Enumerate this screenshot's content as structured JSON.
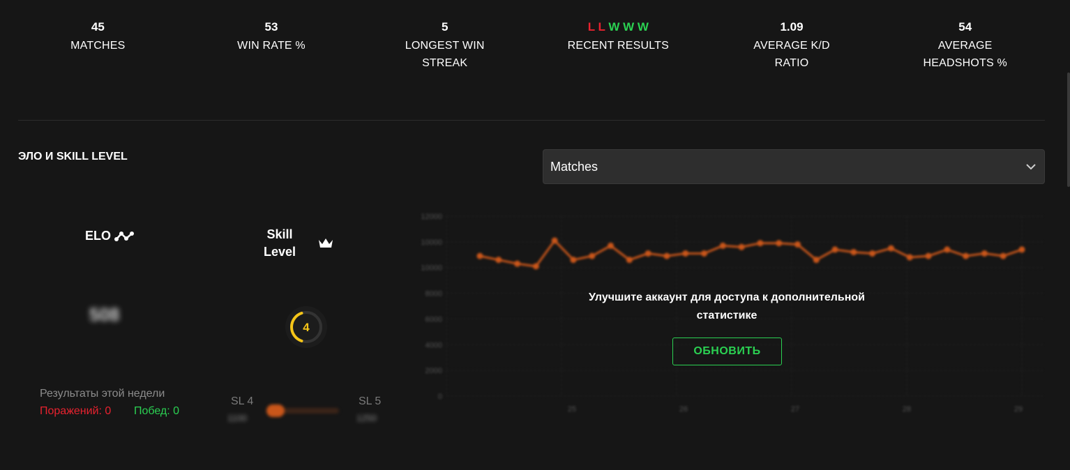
{
  "stats": [
    {
      "value": "45",
      "label": "MATCHES"
    },
    {
      "value": "53",
      "label": "WIN RATE %"
    },
    {
      "value": "5",
      "label": "LONGEST WIN\nSTREAK"
    },
    {
      "value": "",
      "label": "RECENT RESULTS"
    },
    {
      "value": "1.09",
      "label": "AVERAGE K/D\nRATIO"
    },
    {
      "value": "54",
      "label": "AVERAGE\nHEADSHOTS %"
    }
  ],
  "recent_results": [
    "L",
    "L",
    "W",
    "W",
    "W"
  ],
  "colors": {
    "loss": "#e8222f",
    "win": "#2bd152",
    "accent": "#c9561a",
    "skill": "#f5c518"
  },
  "section": {
    "title": "ЭЛО И SKILL LEVEL"
  },
  "dropdown": {
    "selected": "Matches",
    "icon": "chevron-down-icon"
  },
  "elo": {
    "title": "ELO",
    "icon": "elo-graph-icon",
    "value_blurred": "508"
  },
  "skill": {
    "title": "Skill\nLevel",
    "icon": "crown-icon",
    "level": "4",
    "level_fraction": 0.4
  },
  "week": {
    "title": "Результаты этой недели",
    "losses": "Поражений: 0",
    "wins": "Побед: 0"
  },
  "progress": {
    "from": "SL 4",
    "to": "SL 5",
    "from_elo": "1100",
    "to_elo": "1250",
    "fraction": 0.1
  },
  "overlay": {
    "message": "Улучшите аккаунт для доступа к дополнительной\nстатистике",
    "button": "ОБНОВИТЬ"
  },
  "chart_data": {
    "type": "line",
    "blurred": true,
    "yticks": [
      "12000",
      "10000",
      "10000",
      "8000",
      "6000",
      "4000",
      "2000",
      "0"
    ],
    "xticks": [
      "25",
      "26",
      "27",
      "28",
      "29"
    ],
    "ylim": [
      0,
      1400
    ],
    "values": [
      1090,
      1060,
      1030,
      1010,
      1210,
      1060,
      1090,
      1170,
      1060,
      1110,
      1090,
      1110,
      1110,
      1170,
      1160,
      1190,
      1190,
      1180,
      1060,
      1140,
      1120,
      1110,
      1150,
      1080,
      1090,
      1140,
      1090,
      1110,
      1090,
      1140
    ],
    "grid": true
  }
}
